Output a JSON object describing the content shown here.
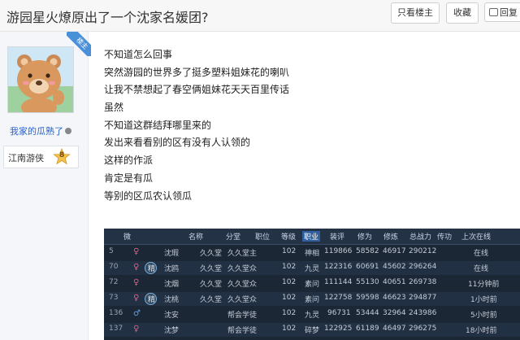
{
  "header": {
    "title": "游园星火燎原出了一个沈家名媛团?",
    "only_op_label": "只看楼主",
    "favorite_label": "收藏",
    "reply_label": "回复"
  },
  "author": {
    "badge": "楼主",
    "name": "我家的瓜熟了",
    "level_title": "江南游侠",
    "level_number": "8"
  },
  "post": {
    "lines": [
      "不知道怎么回事",
      "突然游园的世界多了挺多塑料姐妹花的喇叭",
      "让我不禁想起了春空俩姐妹花天天百里传话",
      "虽然",
      "不知道这群结拜哪里来的",
      "发出来看看别的区有没有人认领的",
      "这样的作派",
      "肯定是有瓜",
      "等别的区瓜农认领瓜"
    ]
  },
  "screenshot": {
    "headers": [
      "微",
      "名称",
      "分堂",
      "职位",
      "等级",
      "职业",
      "装评",
      "修为",
      "修炼",
      "总战力",
      "传功",
      "上次在线"
    ],
    "rows": [
      {
        "idx": "5",
        "sex": "♀",
        "spirit": "",
        "name": "沈瑕",
        "branch": "久久堂",
        "position": "久久堂主",
        "level": "102",
        "job": "神相",
        "gear": "119866",
        "cult": "58582",
        "train": "46917",
        "power": "290212",
        "last": "在线"
      },
      {
        "idx": "70",
        "sex": "♀",
        "spirit": "精",
        "name": "沈鸥",
        "branch": "久久堂",
        "position": "久久堂众",
        "level": "102",
        "job": "九灵",
        "gear": "122316",
        "cult": "60691",
        "train": "45602",
        "power": "296264",
        "last": "在线"
      },
      {
        "idx": "72",
        "sex": "♀",
        "spirit": "",
        "name": "沈烟",
        "branch": "久久堂",
        "position": "久久堂众",
        "level": "102",
        "job": "素问",
        "gear": "111144",
        "cult": "55130",
        "train": "40651",
        "power": "269738",
        "last": "11分钟前"
      },
      {
        "idx": "73",
        "sex": "♀",
        "spirit": "精",
        "name": "沈桃",
        "branch": "久久堂",
        "position": "久久堂众",
        "level": "102",
        "job": "素问",
        "gear": "122758",
        "cult": "59598",
        "train": "46623",
        "power": "294877",
        "last": "1小时前"
      },
      {
        "idx": "136",
        "sex": "♂",
        "spirit": "",
        "name": "沈安",
        "branch": "",
        "position": "帮会学徒",
        "level": "102",
        "job": "九灵",
        "gear": "96731",
        "cult": "53444",
        "train": "32964",
        "power": "243986",
        "last": "5小时前"
      },
      {
        "idx": "137",
        "sex": "♀",
        "spirit": "",
        "name": "沈梦",
        "branch": "",
        "position": "帮会学徒",
        "level": "102",
        "job": "碎梦",
        "gear": "122925",
        "cult": "61189",
        "train": "46497",
        "power": "296275",
        "last": "18小时前"
      }
    ]
  },
  "colors": {
    "link": "#2a62c9",
    "badge": "#4a90d9",
    "female": "#e55a8a",
    "male": "#5aa0e5"
  }
}
